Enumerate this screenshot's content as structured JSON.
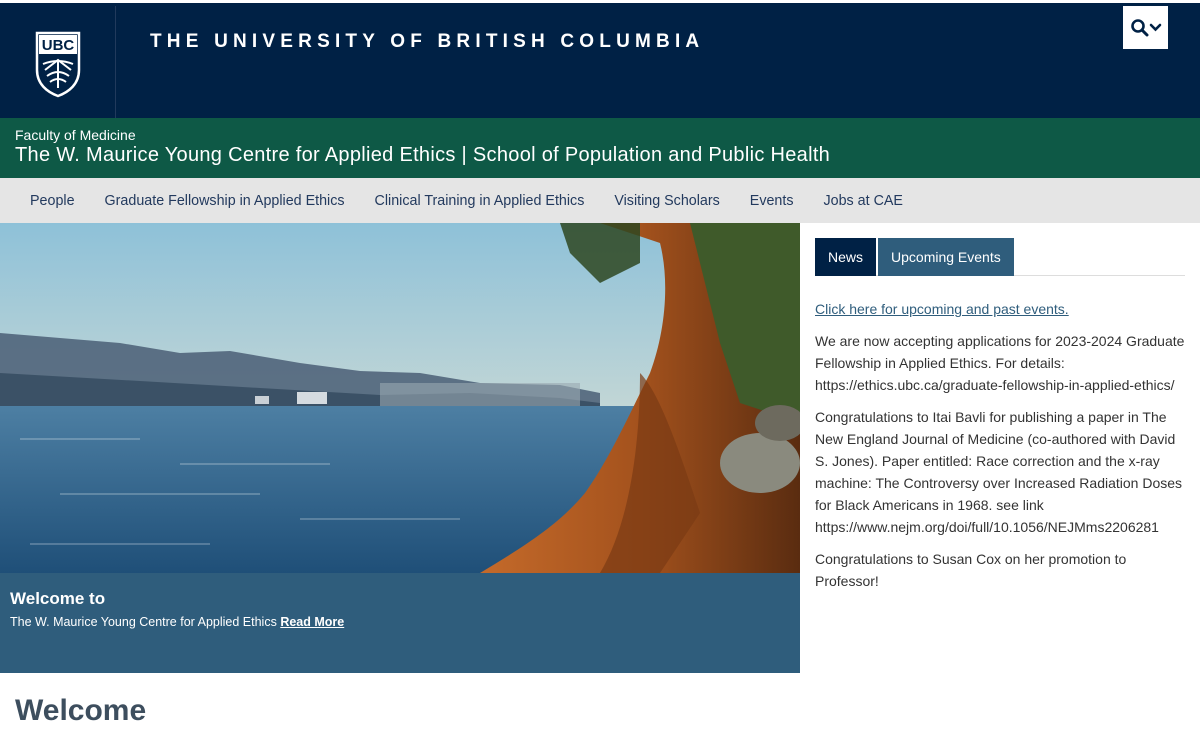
{
  "header": {
    "crest_text": "UBC",
    "wordmark": "THE UNIVERSITY OF BRITISH COLUMBIA",
    "search_icon": "search-icon",
    "dropdown_icon": "chevron-down-icon"
  },
  "unit": {
    "faculty": "Faculty of Medicine",
    "name": "The W. Maurice Young Centre for Applied Ethics | School of Population and Public Health"
  },
  "nav": {
    "items": [
      {
        "label": "People"
      },
      {
        "label": "Graduate Fellowship in Applied Ethics"
      },
      {
        "label": "Clinical Training in Applied Ethics"
      },
      {
        "label": "Visiting Scholars"
      },
      {
        "label": "Events"
      },
      {
        "label": "Jobs at CAE"
      }
    ]
  },
  "hero": {
    "caption_title": "Welcome to",
    "caption_text": "The W. Maurice Young Centre for Applied Ethics",
    "read_more": "Read More"
  },
  "sidebar": {
    "tabs": [
      {
        "label": "News",
        "active": true
      },
      {
        "label": "Upcoming Events",
        "active": false
      }
    ],
    "events_link": "Click here for upcoming and past events.",
    "news_items": [
      {
        "text": "We are now accepting applications for 2023-2024 Graduate Fellowship in Applied Ethics. For details:",
        "url": "https://ethics.ubc.ca/graduate-fellowship-in-applied-ethics/"
      },
      {
        "text": "Congratulations to Itai Bavli for publishing a paper in The New England Journal of Medicine (co-authored with David S. Jones). Paper entitled: Race correction and the x-ray machine: The Controversy over Increased Radiation Doses for Black Americans in 1968. see link",
        "url": "https://www.nejm.org/doi/full/10.1056/NEJMms2206281"
      },
      {
        "text": "Congratulations to Susan Cox on her promotion to Professor!",
        "url": ""
      }
    ]
  },
  "main": {
    "heading": "Welcome"
  },
  "colors": {
    "ubc_blue": "#002145",
    "unit_green": "#0e5946",
    "nav_gray": "#e5e5e5",
    "caption_blue": "#2f5d7c"
  }
}
